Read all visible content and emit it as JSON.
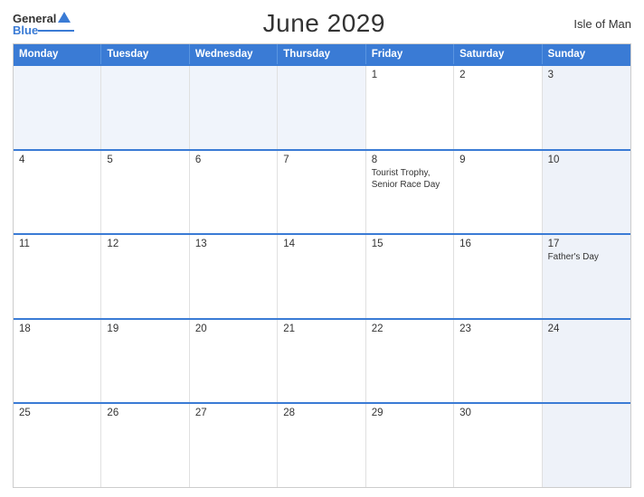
{
  "header": {
    "title": "June 2029",
    "region": "Isle of Man",
    "logo_general": "General",
    "logo_blue": "Blue"
  },
  "weekdays": [
    "Monday",
    "Tuesday",
    "Wednesday",
    "Thursday",
    "Friday",
    "Saturday",
    "Sunday"
  ],
  "weeks": [
    [
      {
        "day": "",
        "event": "",
        "shaded": true
      },
      {
        "day": "",
        "event": "",
        "shaded": true
      },
      {
        "day": "",
        "event": "",
        "shaded": true
      },
      {
        "day": "",
        "event": "",
        "shaded": true
      },
      {
        "day": "1",
        "event": "",
        "shaded": false
      },
      {
        "day": "2",
        "event": "",
        "shaded": false
      },
      {
        "day": "3",
        "event": "",
        "shaded": true
      }
    ],
    [
      {
        "day": "4",
        "event": "",
        "shaded": false
      },
      {
        "day": "5",
        "event": "",
        "shaded": false
      },
      {
        "day": "6",
        "event": "",
        "shaded": false
      },
      {
        "day": "7",
        "event": "",
        "shaded": false
      },
      {
        "day": "8",
        "event": "Tourist Trophy, Senior Race Day",
        "shaded": false
      },
      {
        "day": "9",
        "event": "",
        "shaded": false
      },
      {
        "day": "10",
        "event": "",
        "shaded": true
      }
    ],
    [
      {
        "day": "11",
        "event": "",
        "shaded": false
      },
      {
        "day": "12",
        "event": "",
        "shaded": false
      },
      {
        "day": "13",
        "event": "",
        "shaded": false
      },
      {
        "day": "14",
        "event": "",
        "shaded": false
      },
      {
        "day": "15",
        "event": "",
        "shaded": false
      },
      {
        "day": "16",
        "event": "",
        "shaded": false
      },
      {
        "day": "17",
        "event": "Father's Day",
        "shaded": true
      }
    ],
    [
      {
        "day": "18",
        "event": "",
        "shaded": false
      },
      {
        "day": "19",
        "event": "",
        "shaded": false
      },
      {
        "day": "20",
        "event": "",
        "shaded": false
      },
      {
        "day": "21",
        "event": "",
        "shaded": false
      },
      {
        "day": "22",
        "event": "",
        "shaded": false
      },
      {
        "day": "23",
        "event": "",
        "shaded": false
      },
      {
        "day": "24",
        "event": "",
        "shaded": true
      }
    ],
    [
      {
        "day": "25",
        "event": "",
        "shaded": false
      },
      {
        "day": "26",
        "event": "",
        "shaded": false
      },
      {
        "day": "27",
        "event": "",
        "shaded": false
      },
      {
        "day": "28",
        "event": "",
        "shaded": false
      },
      {
        "day": "29",
        "event": "",
        "shaded": false
      },
      {
        "day": "30",
        "event": "",
        "shaded": false
      },
      {
        "day": "",
        "event": "",
        "shaded": true
      }
    ]
  ]
}
